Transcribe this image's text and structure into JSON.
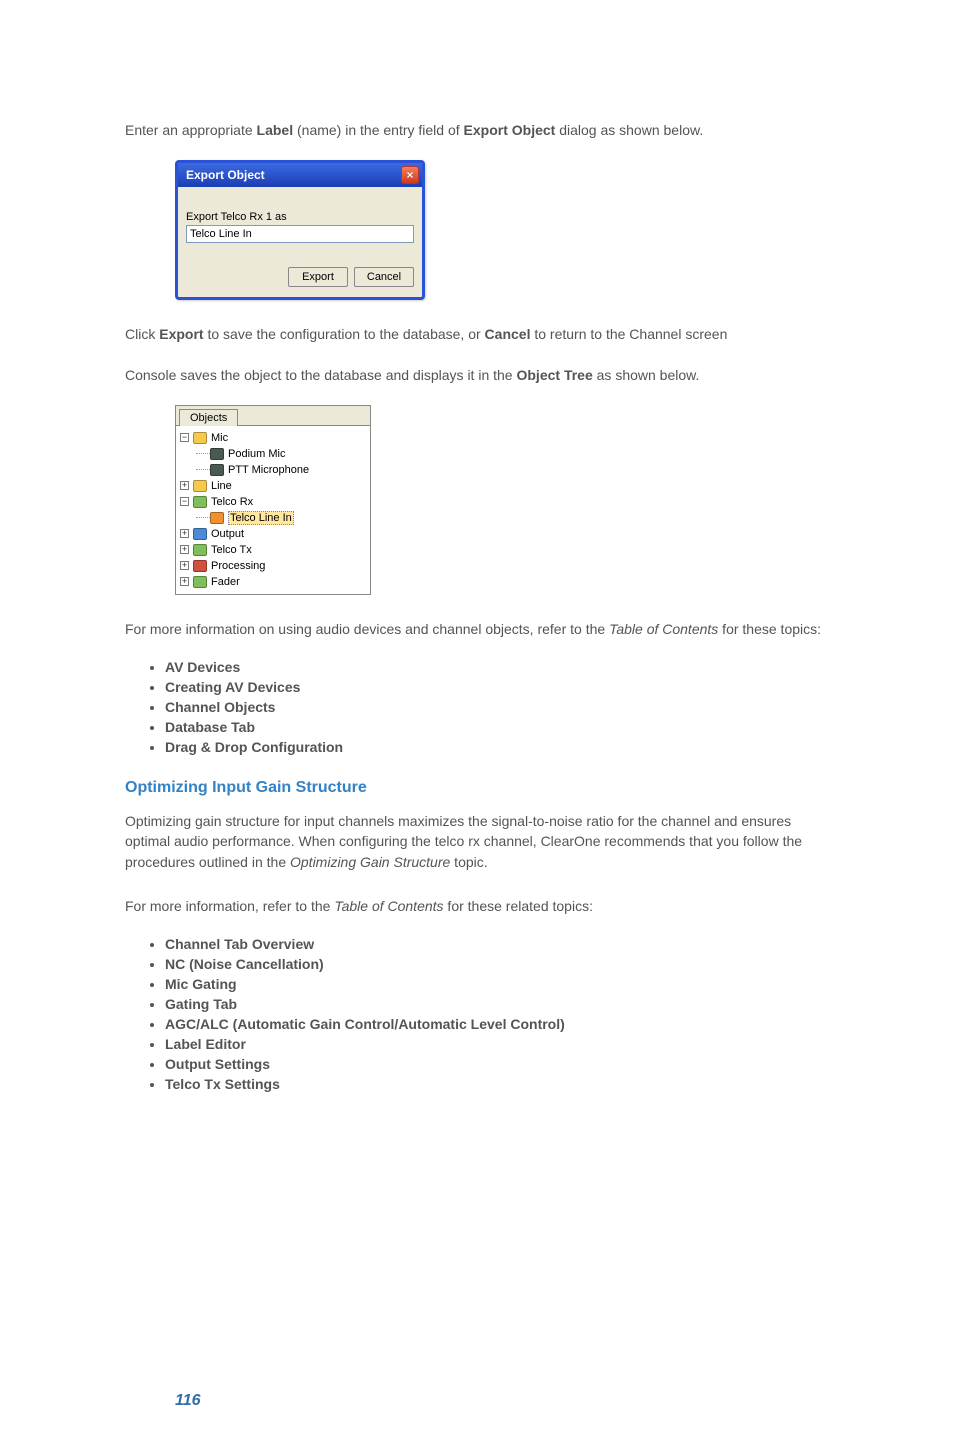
{
  "para1": {
    "t1": "Enter an appropriate ",
    "b1": "Label",
    "t2": " (name) in the entry field of ",
    "b2": "Export Object",
    "t3": " dialog as shown below."
  },
  "dialog": {
    "title": "Export Object",
    "close_glyph": "×",
    "field_label": "Export Telco Rx 1 as",
    "field_value": "Telco Line In",
    "export_btn": "Export",
    "cancel_btn": "Cancel"
  },
  "para2": {
    "t1": "Click ",
    "b1": "Export",
    "t2": " to save the configuration to the database, or ",
    "b2": "Cancel",
    "t3": " to return to the Channel screen"
  },
  "para3": {
    "t1": "Console saves the object to the database and displays it in the ",
    "b1": "Object Tree",
    "t2": " as shown below."
  },
  "tree": {
    "tab": "Objects",
    "nodes": {
      "mic": "Mic",
      "podium": "Podium Mic",
      "ptt": "PTT Microphone",
      "line": "Line",
      "telcorx": "Telco Rx",
      "telcoline": "Telco Line In",
      "output": "Output",
      "telcotx": "Telco Tx",
      "processing": "Processing",
      "fader": "Fader"
    }
  },
  "para4": {
    "t1": "For more information on using audio devices and channel objects, refer to the ",
    "i1": "Table of Contents",
    "t2": " for these topics:"
  },
  "list1": [
    "AV Devices",
    "Creating AV Devices",
    "Channel Objects",
    "Database Tab",
    "Drag & Drop Configuration"
  ],
  "section_head": "Optimizing Input Gain Structure",
  "para5": {
    "t1": "Optimizing gain structure for input channels maximizes the signal-to-noise ratio for the channel and ensures optimal audio performance. When configuring the telco rx channel, ClearOne recommends that you follow the procedures outlined in the ",
    "i1": "Optimizing Gain Structure",
    "t2": " topic."
  },
  "para6": {
    "t1": "For more information, refer to the ",
    "i1": "Table of Contents",
    "t2": " for these related topics:"
  },
  "list2": [
    "Channel Tab Overview",
    "NC (Noise Cancellation)",
    "Mic Gating",
    "Gating Tab",
    "AGC/ALC (Automatic Gain Control/Automatic Level Control)",
    "Label Editor",
    "Output Settings",
    "Telco Tx Settings"
  ],
  "page_number": "116"
}
